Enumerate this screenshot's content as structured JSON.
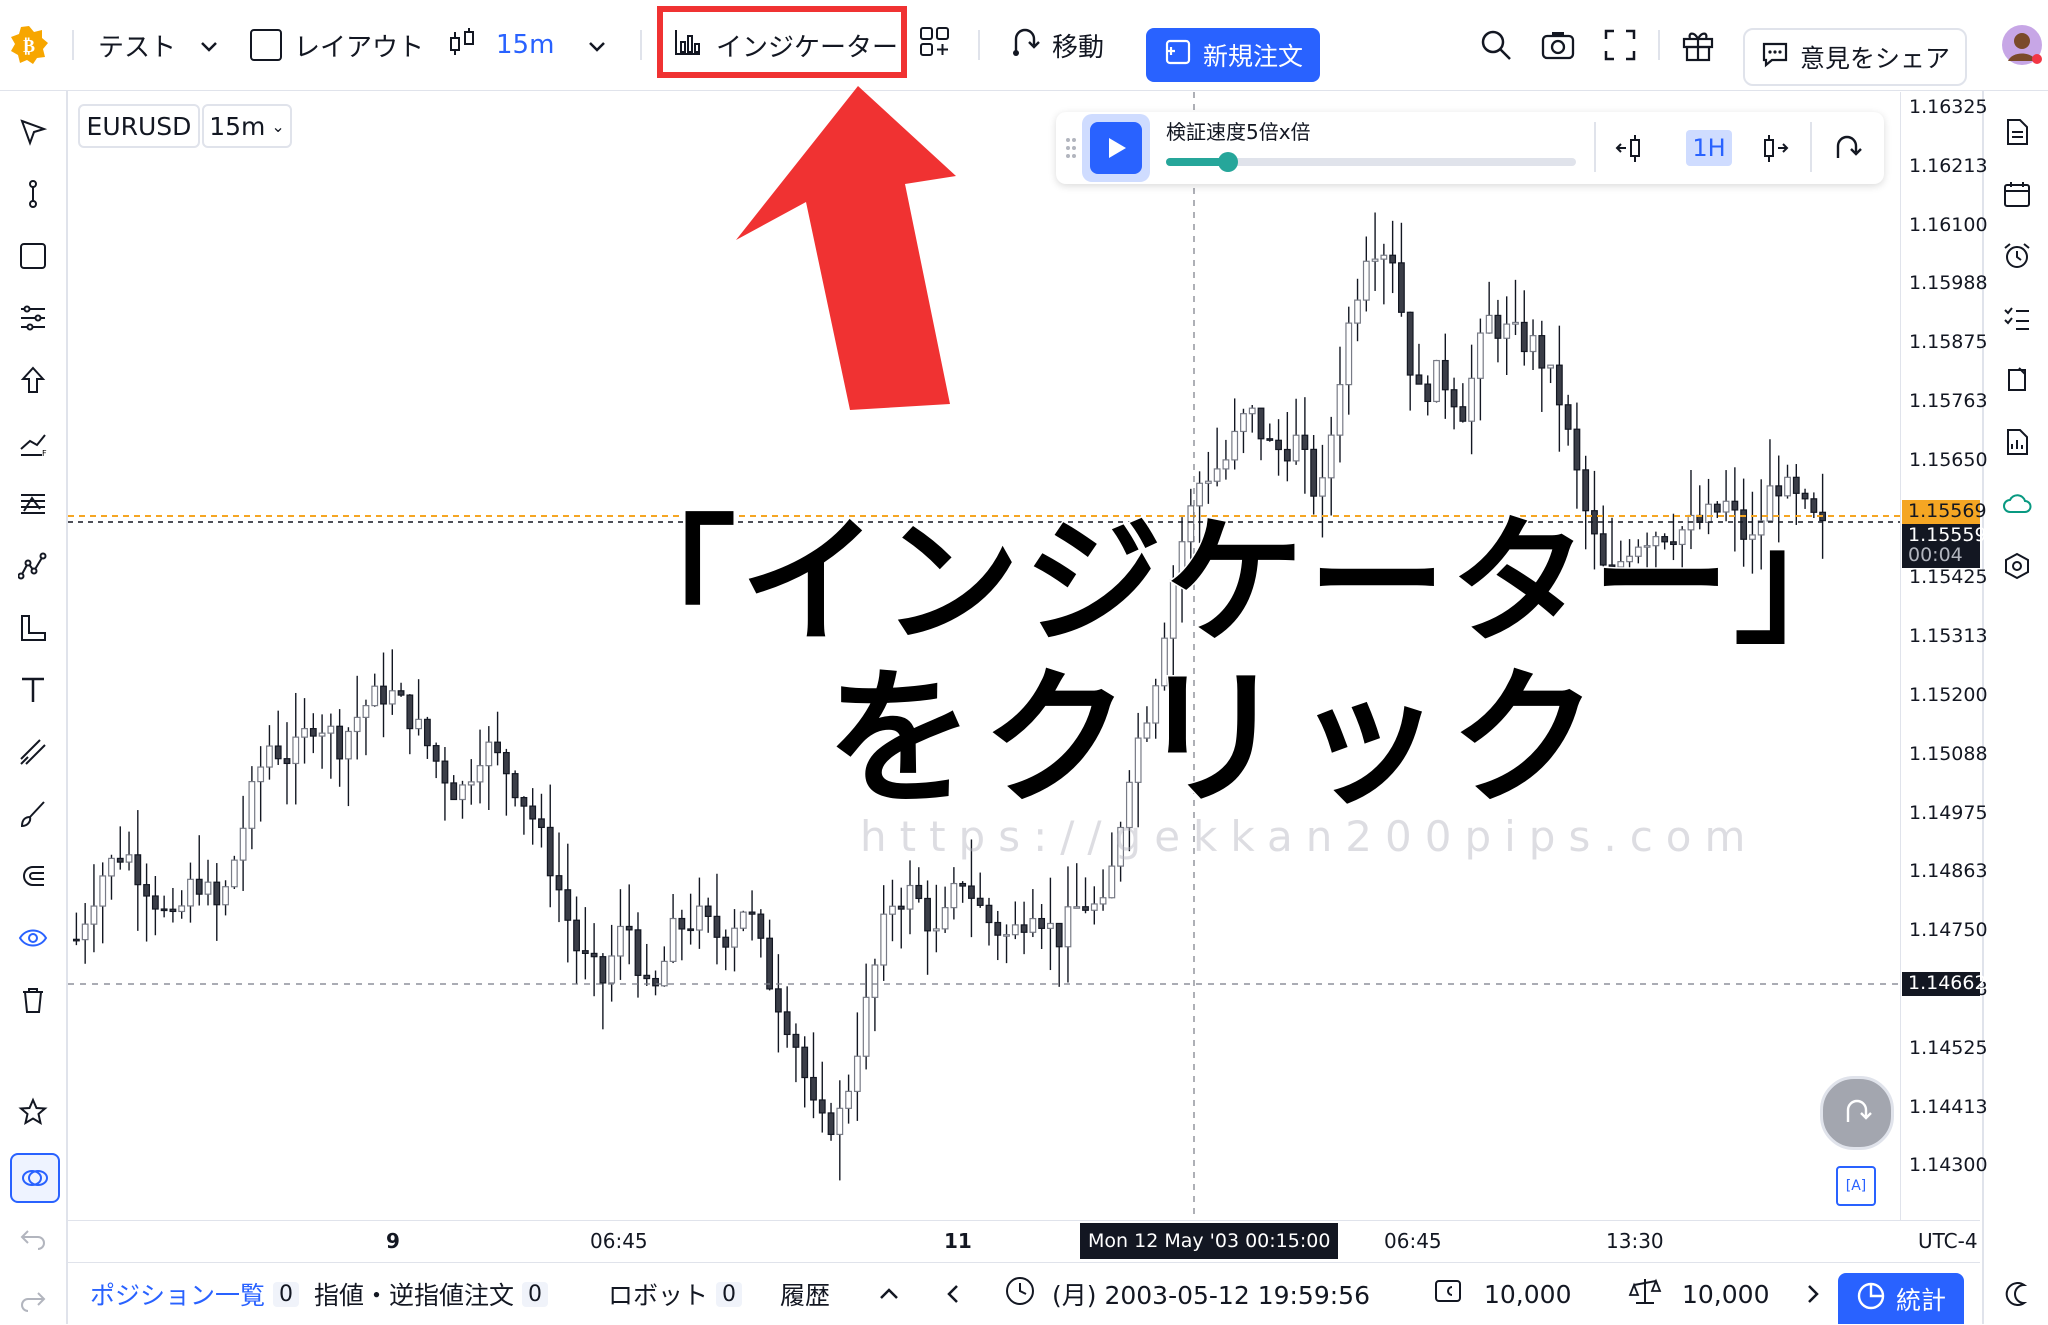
{
  "topbar": {
    "layout_name": "テスト",
    "layout_checkbox_label": "レイアウト",
    "interval": "15m",
    "indicators_label": "インジケーター",
    "move_label": "移動",
    "new_order_label": "新規注文",
    "share_label": "意見をシェア"
  },
  "symbol": {
    "name": "EURUSD",
    "interval": "15m"
  },
  "replay": {
    "speed_label": "検証速度5倍x倍",
    "speed_fraction": 0.15,
    "interval_button": "1H"
  },
  "price_axis": {
    "ticks": [
      "1.16325",
      "1.16213",
      "1.16100",
      "1.15988",
      "1.15875",
      "1.15763",
      "1.15650",
      "1.15425",
      "1.15313",
      "1.15200",
      "1.15088",
      "1.14975",
      "1.14863",
      "1.14750",
      "1.14638",
      "1.14525",
      "1.14413",
      "1.14300"
    ],
    "current_price": "1.15569",
    "last_price": "1.15559",
    "countdown": "00:04",
    "crosshair_price": "1.14662",
    "current_price_color": "#f5a623"
  },
  "time_axis": {
    "labels": [
      "9",
      "06:45",
      "11",
      "06:45",
      "13:30"
    ],
    "crosshair_time": "Mon 12 May '03 00:15:00",
    "timezone": "UTC-4"
  },
  "bottombar": {
    "positions_label": "ポジション一覧",
    "positions_count": "0",
    "orders_label": "指値・逆指値注文",
    "orders_count": "0",
    "robot_label": "ロボット",
    "robot_count": "0",
    "history_label": "履歴",
    "datetime": "(月) 2003-05-12 19:59:56",
    "balance": "10,000",
    "equity": "10,000",
    "stats_label": "統計"
  },
  "overlay": {
    "caption_line1": "「インジケーター」",
    "caption_line2": "をクリック",
    "watermark": "https://gekkan200pips.com",
    "highlight_color": "#f03232"
  },
  "chart_data": {
    "type": "candlestick",
    "symbol": "EURUSD",
    "interval": "15m",
    "ylim": [
      1.1425,
      1.1638
    ],
    "price_trend": [
      1.1478,
      1.149,
      1.1495,
      1.1488,
      1.148,
      1.149,
      1.1483,
      1.15,
      1.1515,
      1.1512,
      1.152,
      1.1515,
      1.1522,
      1.1525,
      1.152,
      1.1512,
      1.1505,
      1.1515,
      1.151,
      1.1502,
      1.149,
      1.1475,
      1.147,
      1.1482,
      1.1465,
      1.148,
      1.1482,
      1.1478,
      1.1485,
      1.147,
      1.146,
      1.1442,
      1.1445,
      1.1465,
      1.1485,
      1.1487,
      1.1478,
      1.149,
      1.1482,
      1.1478,
      1.1485,
      1.1478,
      1.1485,
      1.1483,
      1.151,
      1.1525,
      1.155,
      1.1565,
      1.1568,
      1.1578,
      1.157,
      1.1572,
      1.156,
      1.159,
      1.161,
      1.1608,
      1.158,
      1.1585,
      1.1578,
      1.1595,
      1.1592,
      1.159,
      1.158,
      1.156,
      1.1545,
      1.1553,
      1.1555,
      1.1555,
      1.1557,
      1.156,
      1.1552,
      1.1565,
      1.156,
      1.1555
    ]
  }
}
